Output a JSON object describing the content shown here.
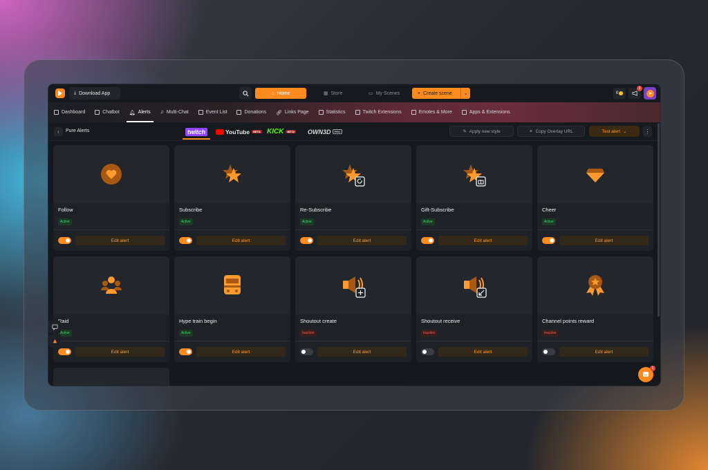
{
  "topbar": {
    "download_label": "Download App",
    "home_label": "Home",
    "store_label": "Store",
    "scenes_label": "My Scenes",
    "create_label": "Create scene",
    "coins": "0",
    "notif_count": "3"
  },
  "secnav": {
    "items": [
      {
        "label": "Dashboard"
      },
      {
        "label": "Chatbot"
      },
      {
        "label": "Alerts"
      },
      {
        "label": "Multi-Chat"
      },
      {
        "label": "Event List"
      },
      {
        "label": "Donations"
      },
      {
        "label": "Links Page"
      },
      {
        "label": "Statistics"
      },
      {
        "label": "Twitch Extensions"
      },
      {
        "label": "Emotes & More"
      },
      {
        "label": "Apps & Extensions"
      }
    ]
  },
  "subhead": {
    "title": "Pure Alerts",
    "platforms": {
      "twitch": "twitch",
      "youtube": "YouTube",
      "youtube_badge": "BETA",
      "kick": "KICK",
      "kick_badge": "BETA",
      "own3d": "OWN3D",
      "own3d_badge": "PRO"
    },
    "apply_style": "Apply new style",
    "copy_url": "Copy Overlay URL",
    "test_alert": "Test alert"
  },
  "cards": [
    {
      "title": "Follow",
      "status": "Active",
      "edit": "Edit alert",
      "icon": "heart-icon"
    },
    {
      "title": "Subscribe",
      "status": "Active",
      "edit": "Edit alert",
      "icon": "star-icon"
    },
    {
      "title": "Re-Subscribe",
      "status": "Active",
      "edit": "Edit alert",
      "icon": "star-repeat-icon"
    },
    {
      "title": "Gift-Subscribe",
      "status": "Active",
      "edit": "Edit alert",
      "icon": "star-gift-icon"
    },
    {
      "title": "Cheer",
      "status": "Active",
      "edit": "Edit alert",
      "icon": "gem-icon"
    },
    {
      "title": "Raid",
      "status": "Active",
      "edit": "Edit alert",
      "icon": "group-icon"
    },
    {
      "title": "Hype train begin",
      "status": "Active",
      "edit": "Edit alert",
      "icon": "train-icon"
    },
    {
      "title": "Shoutout create",
      "status": "Inactive",
      "edit": "Edit alert",
      "icon": "megaphone-plus-icon"
    },
    {
      "title": "Shoutout receive",
      "status": "Inactive",
      "edit": "Edit alert",
      "icon": "megaphone-receive-icon"
    },
    {
      "title": "Channel points reward",
      "status": "Inactive",
      "edit": "Edit alert",
      "icon": "medal-icon"
    }
  ],
  "chat_badge": "1",
  "colors": {
    "accent": "#ff8a1e",
    "active": "#3ddc6e",
    "inactive": "#ff5a4e"
  }
}
